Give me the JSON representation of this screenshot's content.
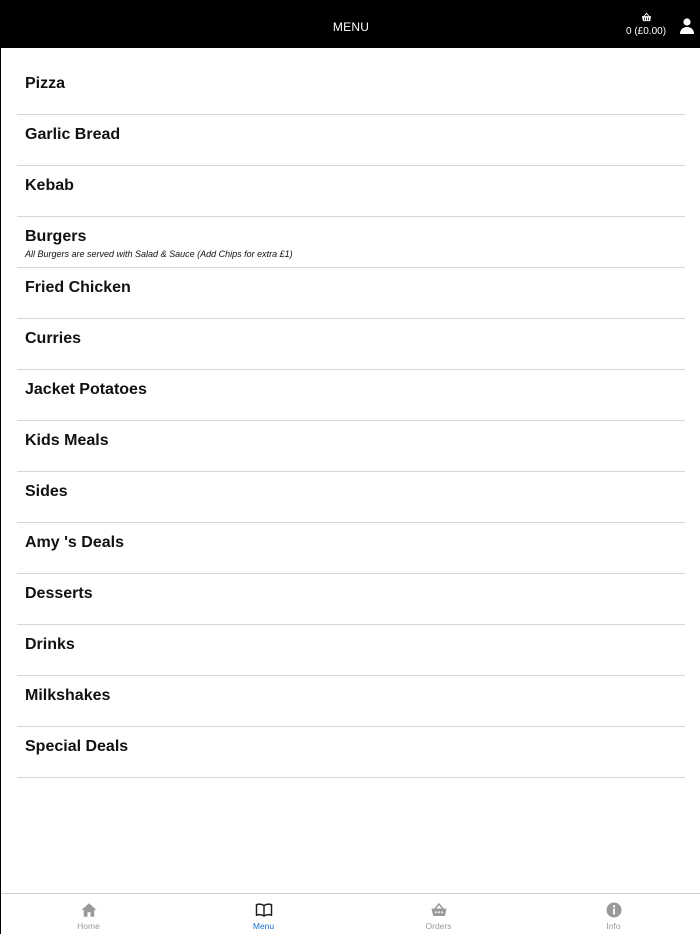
{
  "header": {
    "title": "MENU",
    "basket_count": "0 (£0.00)",
    "basket_icon": "basket-icon",
    "account_icon": "user-icon"
  },
  "menu": {
    "items": [
      {
        "label": "Pizza"
      },
      {
        "label": "Garlic Bread"
      },
      {
        "label": "Kebab"
      },
      {
        "label": "Burgers",
        "note": "All Burgers are served with Salad & Sauce  (Add Chips for extra £1)"
      },
      {
        "label": "Fried Chicken"
      },
      {
        "label": "Curries"
      },
      {
        "label": "Jacket Potatoes"
      },
      {
        "label": "Kids Meals"
      },
      {
        "label": "Sides"
      },
      {
        "label": "Amy 's Deals"
      },
      {
        "label": "Desserts"
      },
      {
        "label": "Drinks"
      },
      {
        "label": "Milkshakes"
      },
      {
        "label": "Special Deals"
      }
    ]
  },
  "tabbar": {
    "tabs": [
      {
        "label": "Home",
        "icon": "home-icon"
      },
      {
        "label": "Menu",
        "icon": "book-icon",
        "active": true
      },
      {
        "label": "Orders",
        "icon": "basket-icon"
      },
      {
        "label": "Info",
        "icon": "info-icon"
      }
    ]
  },
  "colors": {
    "header_bg": "#000000",
    "active_tab": "#1a73c8",
    "inactive_tab": "#9a9a9a",
    "divider": "#d6d6d6"
  }
}
